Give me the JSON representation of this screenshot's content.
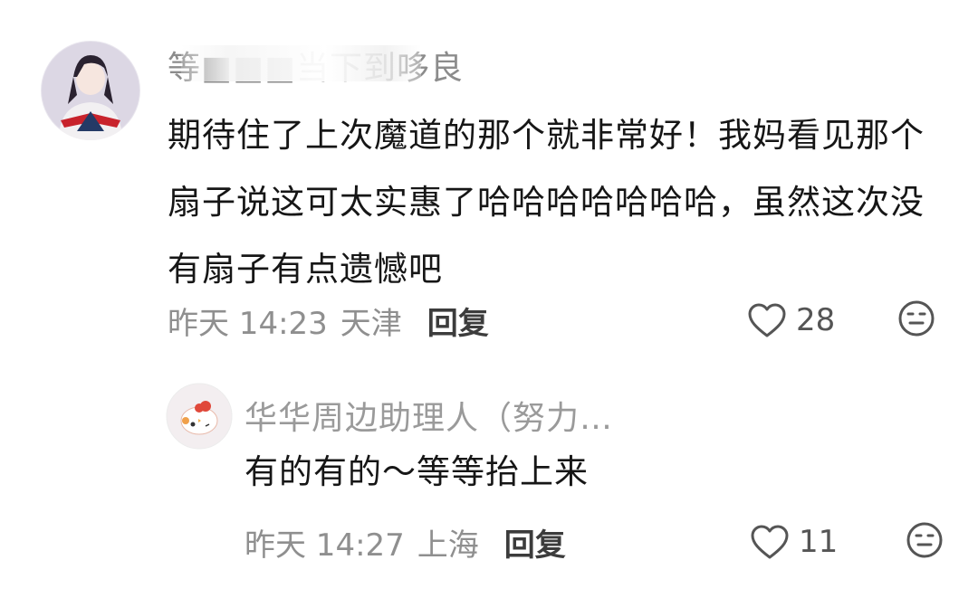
{
  "comments": [
    {
      "username": "等■■■当下到哆良",
      "content": "期待住了上次魔道的那个就非常好！我妈看见那个扇子说这可太实惠了哈哈哈哈哈哈哈，虽然这次没有扇子有点遗憾吧",
      "time": "昨天 14:23",
      "location": "天津",
      "reply_label": "回复",
      "likes": "28"
    },
    {
      "username": "华华周边助理人（努力…",
      "content": "有的有的～等等抬上来",
      "time": "昨天 14:27",
      "location": "上海",
      "reply_label": "回复",
      "likes": "11"
    }
  ],
  "icons": {
    "like": "heart-outline-icon",
    "emoji": "meh-face-icon"
  },
  "colors": {
    "text": "#161616",
    "muted": "#8f8f8f",
    "reply": "#3c3c3c"
  }
}
